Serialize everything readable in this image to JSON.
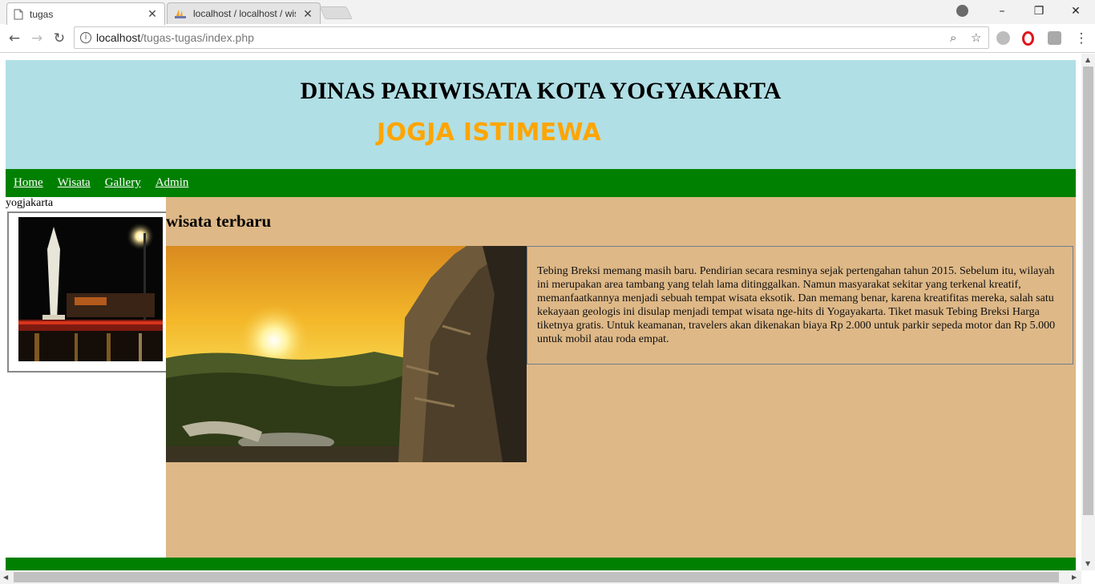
{
  "browser": {
    "tabs": [
      {
        "title": "tugas",
        "active": true
      },
      {
        "title": "localhost / localhost / wis",
        "active": false
      }
    ],
    "url_host": "localhost",
    "url_path": "/tugas-tugas/index.php",
    "window_controls": {
      "minimize": "–",
      "maximize": "❐",
      "close": "✕"
    }
  },
  "header": {
    "title": "DINAS PARIWISATA KOTA YOGYAKARTA",
    "subtitle": "JOGJA ISTIMEWA"
  },
  "menu": [
    "Home",
    "Wisata",
    "Gallery",
    "Admin"
  ],
  "sidebar": {
    "label": "yogjakarta"
  },
  "main": {
    "heading": "wisata terbaru",
    "article": "Tebing Breksi memang masih baru. Pendirian secara resminya sejak pertengahan tahun 2015. Sebelum itu, wilayah ini merupakan area tambang yang telah lama ditinggalkan. Namun masyarakat sekitar yang terkenal kreatif, memanfaatkannya menjadi sebuah tempat wisata eksotik. Dan memang benar, karena kreatifitas mereka, salah satu kekayaan geologis ini disulap menjadi tempat wisata nge-hits di Yogayakarta. Tiket masuk Tebing Breksi Harga tiketnya gratis. Untuk keamanan, travelers akan dikenakan biaya Rp 2.000 untuk parkir sepeda motor dan Rp 5.000 untuk mobil atau roda empat."
  },
  "colors": {
    "header_bg": "#b0dfe5",
    "subtitle": "#ffa500",
    "menu_bg": "#008000",
    "main_bg": "#deb887"
  }
}
